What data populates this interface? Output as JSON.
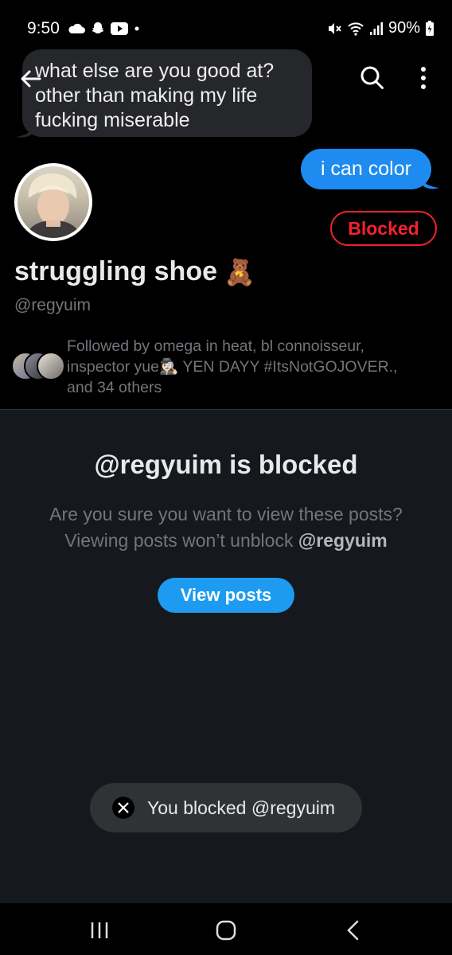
{
  "status_bar": {
    "time": "9:50",
    "battery": "90%",
    "left_icons": [
      "cloud-icon",
      "snapchat-icon",
      "youtube-icon",
      "dot-icon"
    ],
    "right_icons": [
      "mute-icon",
      "wifi-icon",
      "signal-icon",
      "battery-charging-icon"
    ]
  },
  "header": {
    "icons": [
      "back-arrow-icon",
      "search-icon",
      "more-vertical-icon"
    ]
  },
  "banner": {
    "gray_bubble_text": "what else are you good at?\nother than making my life\nfucking miserable",
    "blue_bubble_text": "i can color"
  },
  "profile": {
    "display_name": "struggling shoe",
    "name_emoji": "🧸",
    "handle": "@regyuim",
    "blocked_label": "Blocked",
    "followed_by": "Followed by omega in heat, bl connoisseur, inspector yue🕵🏻‍♀️ YEN DAYY #ItsNotGOJOVER., and 34 others"
  },
  "blocked_panel": {
    "title": "@regyuim is blocked",
    "line1": "Are you sure you want to view these posts?",
    "line2_prefix": "Viewing posts won’t unblock ",
    "line2_handle": "@regyuim",
    "view_button": "View posts"
  },
  "toast": {
    "text": "You blocked @regyuim",
    "icon": "x-logo-icon"
  },
  "nav_bar": {
    "icons": [
      "recent-apps-icon",
      "home-icon",
      "back-icon"
    ]
  },
  "colors": {
    "background": "#000000",
    "panel": "#15181c",
    "accent_blue": "#1d9bf0",
    "blocked_red": "#f4212e",
    "muted_text": "#71767b"
  }
}
